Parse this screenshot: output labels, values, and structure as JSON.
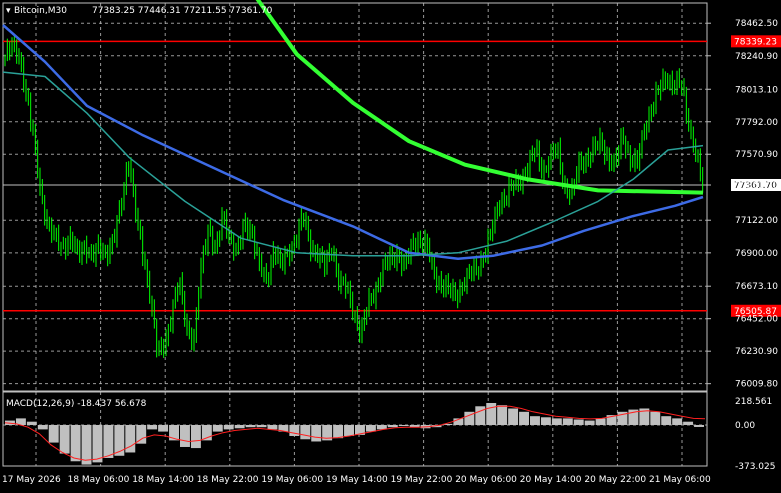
{
  "header": {
    "symbol_timeframe": "Bitcoin,M30",
    "ohlc": "77383.25 77446.31 77211.55 77361.70"
  },
  "colors": {
    "background": "#000000",
    "grid": "#c0c0c0",
    "candle_up": "#00ff00",
    "candle_down": "#00ff00",
    "ma_long": "#33ff33",
    "ma_mid": "#3d6be6",
    "ma_short": "#2aa198",
    "level_line": "#ff0000",
    "macd_hist": "#c0c0c0",
    "macd_signal": "#ff2020"
  },
  "chart_data": [
    {
      "type": "candlestick",
      "symbol": "Bitcoin",
      "timeframe": "M30",
      "ylim": [
        75960,
        78600
      ],
      "y_ticks": [
        "78462.50",
        "78240.90",
        "78013.10",
        "77792.00",
        "77570.90",
        "77361.70",
        "77122.00",
        "76900.00",
        "76673.10",
        "76452.00",
        "76230.90",
        "76009.80"
      ],
      "x_ticks": [
        "17 May 2026",
        "18 May 06:00",
        "18 May 14:00",
        "18 May 22:00",
        "19 May 06:00",
        "19 May 14:00",
        "19 May 22:00",
        "20 May 06:00",
        "20 May 14:00",
        "20 May 22:00",
        "21 May 06:00"
      ],
      "current_price": {
        "label": "77361.70",
        "value": 77361.7
      },
      "levels": [
        {
          "label": "78339.23",
          "value": 78339.23
        },
        {
          "label": "76505.87",
          "value": 76505.87
        }
      ],
      "close_path": [
        78230,
        78300,
        78250,
        77950,
        77650,
        77300,
        77050,
        77000,
        76950,
        76980,
        76900,
        76960,
        76850,
        76950,
        76900,
        76980,
        77250,
        77550,
        77150,
        76900,
        76600,
        76200,
        76300,
        76500,
        76700,
        76400,
        76300,
        76800,
        77100,
        76900,
        77150,
        77000,
        76900,
        77100,
        77050,
        76800,
        76700,
        76950,
        76800,
        76900,
        77000,
        77150,
        76950,
        76900,
        76800,
        76950,
        76700,
        76650,
        76500,
        76350,
        76550,
        76650,
        76800,
        76850,
        76900,
        76800,
        76950,
        77000,
        76950,
        76750,
        76700,
        76650,
        76600,
        76700,
        76750,
        76800,
        76900,
        77050,
        77250,
        77300,
        77350,
        77400,
        77500,
        77600,
        77450,
        77550,
        77600,
        77350,
        77300,
        77500,
        77550,
        77600,
        77650,
        77550,
        77500,
        77700,
        77550,
        77500,
        77750,
        77900,
        78000,
        78100,
        78050,
        78050,
        77800,
        77600,
        77350
      ],
      "indicator_lines": [
        {
          "id": "ma-long",
          "path": [
            [
              0.36,
              78650
            ],
            [
              0.42,
              78250
            ],
            [
              0.5,
              77920
            ],
            [
              0.58,
              77660
            ],
            [
              0.66,
              77500
            ],
            [
              0.75,
              77400
            ],
            [
              0.85,
              77325
            ],
            [
              1.0,
              77310
            ]
          ]
        },
        {
          "id": "ma-mid",
          "path": [
            [
              0.0,
              78450
            ],
            [
              0.06,
              78200
            ],
            [
              0.12,
              77900
            ],
            [
              0.2,
              77700
            ],
            [
              0.3,
              77480
            ],
            [
              0.4,
              77260
            ],
            [
              0.5,
              77080
            ],
            [
              0.58,
              76900
            ],
            [
              0.65,
              76860
            ],
            [
              0.7,
              76880
            ],
            [
              0.77,
              76950
            ],
            [
              0.83,
              77050
            ],
            [
              0.9,
              77150
            ],
            [
              0.96,
              77220
            ],
            [
              1.0,
              77280
            ]
          ]
        },
        {
          "id": "ma-short",
          "path": [
            [
              0.0,
              78130
            ],
            [
              0.06,
              78100
            ],
            [
              0.12,
              77850
            ],
            [
              0.18,
              77550
            ],
            [
              0.26,
              77250
            ],
            [
              0.34,
              77000
            ],
            [
              0.42,
              76900
            ],
            [
              0.5,
              76880
            ],
            [
              0.58,
              76880
            ],
            [
              0.65,
              76900
            ],
            [
              0.72,
              76980
            ],
            [
              0.78,
              77100
            ],
            [
              0.85,
              77250
            ],
            [
              0.9,
              77400
            ],
            [
              0.95,
              77600
            ],
            [
              1.0,
              77630
            ]
          ]
        }
      ]
    },
    {
      "type": "bar",
      "label": "MACD(12,26,9) -18.437 56.678",
      "ylim": [
        -373.025,
        300
      ],
      "y_ticks": [
        "218.561",
        "0.00",
        "-373.025"
      ],
      "histogram": [
        40,
        60,
        30,
        -40,
        -160,
        -260,
        -330,
        -360,
        -340,
        -300,
        -280,
        -250,
        -170,
        -40,
        -60,
        -140,
        -200,
        -210,
        -140,
        -60,
        -40,
        -30,
        -20,
        -20,
        -40,
        -60,
        -100,
        -130,
        -150,
        -140,
        -120,
        -100,
        -90,
        -60,
        -40,
        -20,
        -10,
        -20,
        -30,
        -20,
        10,
        60,
        120,
        170,
        200,
        180,
        150,
        120,
        80,
        70,
        60,
        60,
        50,
        40,
        60,
        90,
        120,
        140,
        150,
        120,
        80,
        60,
        30,
        -18
      ],
      "signal": [
        20,
        10,
        -20,
        -80,
        -180,
        -250,
        -300,
        -320,
        -310,
        -280,
        -240,
        -190,
        -120,
        -90,
        -100,
        -130,
        -150,
        -140,
        -100,
        -70,
        -50,
        -40,
        -30,
        -40,
        -50,
        -70,
        -90,
        -110,
        -120,
        -115,
        -100,
        -80,
        -60,
        -40,
        -25,
        -20,
        -20,
        -15,
        0,
        30,
        70,
        110,
        150,
        170,
        170,
        150,
        120,
        100,
        80,
        70,
        60,
        55,
        60,
        80,
        100,
        120,
        130,
        120,
        100,
        80,
        60,
        57
      ]
    }
  ]
}
